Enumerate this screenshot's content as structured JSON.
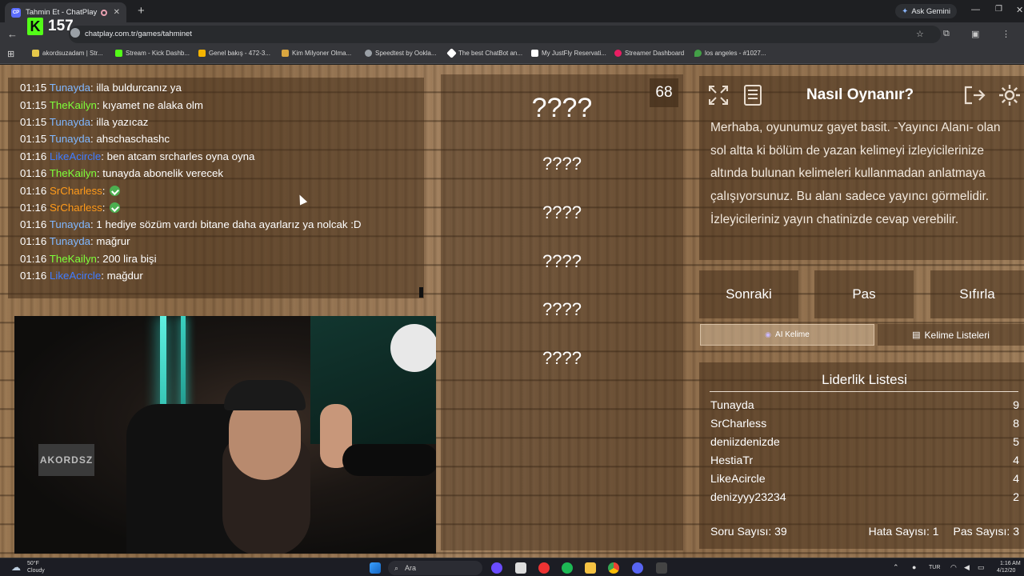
{
  "browser": {
    "tab_title": "Tahmin Et - ChatPlay",
    "tab_favicon": "CP",
    "new_tab": "+",
    "gemini_label": "Ask Gemini",
    "url": "chatplay.com.tr/games/tahminet",
    "kick_letter": "K",
    "kick_viewers": "157",
    "bookmarks": [
      "akordsuzadam | Str...",
      "Stream - Kick Dashb...",
      "Genel bakış - 472-3...",
      "Kim Milyoner Olma...",
      "Speedtest by Ookla...",
      "The best ChatBot an...",
      "My JustFly Reservati...",
      "Streamer Dashboard",
      "los angeles - #1027..."
    ]
  },
  "chat": {
    "messages": [
      {
        "time": "01:15",
        "user": "Tunayda",
        "color": "#7fb7ff",
        "text": ": illa buldurcanız ya"
      },
      {
        "time": "01:15",
        "user": "TheKailyn",
        "color": "#7dff3a",
        "text": ": kıyamet ne alaka olm"
      },
      {
        "time": "01:15",
        "user": "Tunayda",
        "color": "#7fb7ff",
        "text": ": illa yazıcaz"
      },
      {
        "time": "01:15",
        "user": "Tunayda",
        "color": "#7fb7ff",
        "text": ": ahschaschashc"
      },
      {
        "time": "01:16",
        "user": "LikeAcircle",
        "color": "#3f7bff",
        "text": ": ben atcam srcharles oyna oyna"
      },
      {
        "time": "01:16",
        "user": "TheKailyn",
        "color": "#7dff3a",
        "text": ": tunayda abonelik verecek"
      },
      {
        "time": "01:16",
        "user": "SrCharless",
        "color": "#ff9a1a",
        "text": ":"
      },
      {
        "time": "01:16",
        "user": "SrCharless",
        "color": "#ff9a1a",
        "text": ":"
      },
      {
        "time": "01:16",
        "user": "Tunayda",
        "color": "#7fb7ff",
        "text": ": 1 hediye sözüm vardı bitane daha ayarlarız ya nolcak :D"
      },
      {
        "time": "01:16",
        "user": "Tunayda",
        "color": "#7fb7ff",
        "text": ": mağrur"
      },
      {
        "time": "01:16",
        "user": "TheKailyn",
        "color": "#7dff3a",
        "text": ": 200 lira bişi"
      },
      {
        "time": "01:16",
        "user": "LikeAcircle",
        "color": "#3f7bff",
        "text": ": mağdur"
      }
    ]
  },
  "webcam": {
    "sign_text": "AKORDSZ"
  },
  "game": {
    "timer": "68",
    "words": [
      "????",
      "????",
      "????",
      "????",
      "????",
      "????"
    ]
  },
  "howto": {
    "title": "Nasıl Oynanır?",
    "description": "Merhaba, oyunumuz gayet basit. -Yayıncı Alanı- olan sol altta ki bölüm de yazan kelimeyi izleyicilerinize altında bulunan kelimeleri kullanmadan anlatmaya çalışıyorsunuz. Bu alanı sadece yayıncı görmelidir. İzleyicileriniz yayın chatinizde cevap verebilir."
  },
  "controls": {
    "next": "Sonraki",
    "pass": "Pas",
    "reset": "Sıfırla",
    "ai_word": "AI Kelime",
    "word_lists": "Kelime Listeleri"
  },
  "leaderboard": {
    "title": "Liderlik Listesi",
    "rows": [
      {
        "name": "Tunayda",
        "score": "9"
      },
      {
        "name": "SrCharless",
        "score": "8"
      },
      {
        "name": "deniizdenizde",
        "score": "5"
      },
      {
        "name": "HestiaTr",
        "score": "4"
      },
      {
        "name": "LikeAcircle",
        "score": "4"
      },
      {
        "name": "denizyyy23234",
        "score": "2"
      }
    ],
    "question_count": "Soru Sayısı: 39",
    "error_count": "Hata Sayısı: 1",
    "pass_count": "Pas Sayısı: 3"
  },
  "taskbar": {
    "weather_temp": "50°F",
    "weather_desc": "Cloudy",
    "search_label": "Ara",
    "lang": "TUR",
    "time": "1:16 AM",
    "date": "4/12/20"
  }
}
